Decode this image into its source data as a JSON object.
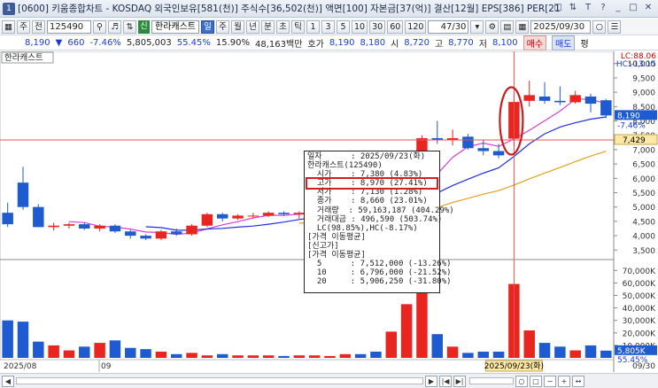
{
  "window": {
    "number": "1",
    "title": "[0600] 키움종합차트 - KOSDAQ 외국인보유[581(천)] 주식수[36,502(천)] 액면[100] 자본금[37(억)] 결산[12월] EPS[386] PER[21.18] 시가총액[2,9"
  },
  "toolbar": {
    "week_label": "주",
    "prev_label": "전",
    "code": "125490",
    "new_badge": "신",
    "stock_name": "한라캐스트",
    "periods": [
      "일",
      "주",
      "월",
      "년",
      "분",
      "초",
      "틱"
    ],
    "active_period": "일",
    "minute_options": [
      "1",
      "3",
      "5",
      "10",
      "30",
      "60",
      "120"
    ],
    "page": "47/30",
    "date": "2025/09/30"
  },
  "quote": {
    "price": "8,190",
    "change": "660",
    "change_pct": "-7.46%",
    "volume": "5,805,003",
    "volume_ratio": "55.45%",
    "turnover": "15.90%",
    "amount": "48,163백만",
    "bid_ask_label": "호가",
    "bid": "8,190",
    "ask": "8,180",
    "open_label": "시",
    "open": "8,720",
    "high_label": "고",
    "high": "8,770",
    "low_label": "저",
    "low": "8,100",
    "buy_label": "매수",
    "sell_label": "매도",
    "avg_label": "평"
  },
  "chart": {
    "name_tag": "한라캐스트",
    "lc_label": "LC:88.06",
    "hc_label": "HC:-13.15",
    "price_ticks": [
      "10,000",
      "9,500",
      "9,000",
      "8,500",
      "8,000",
      "7,500",
      "7,000",
      "6,500",
      "6,000",
      "5,500",
      "5,000",
      "4,500",
      "4,000",
      "3,500"
    ],
    "current_price": "8,190",
    "current_pct": "-7.46%",
    "crosshair_price": "7,429",
    "volume_ticks": [
      "70,000K",
      "60,000K",
      "50,000K",
      "40,000K",
      "30,000K",
      "20,000K",
      "10,000K"
    ],
    "volume_current": "5,805K",
    "volume_pct": "55.45%",
    "x_labels": [
      "2025/08",
      "09"
    ],
    "x_label_right": "09/30",
    "crosshair_date": "2025/09/23(화)",
    "colors": {
      "up": "#e8251f",
      "down": "#1e5bd0",
      "ma5": "#d63fd6",
      "ma10": "#1f2fe0",
      "ma20": "#e0a21e",
      "crosshair": "#e05656"
    }
  },
  "chart_data": {
    "type": "candlestick",
    "dates_visible": "2025/08 - 2025/09/30",
    "candles": [
      {
        "o": 4800,
        "h": 5150,
        "l": 4300,
        "c": 4400
      },
      {
        "o": 5850,
        "h": 6400,
        "l": 4900,
        "c": 5000
      },
      {
        "o": 5000,
        "h": 5100,
        "l": 4300,
        "c": 4300
      },
      {
        "o": 4300,
        "h": 4450,
        "l": 4180,
        "c": 4350
      },
      {
        "o": 4350,
        "h": 4450,
        "l": 4250,
        "c": 4400
      },
      {
        "o": 4400,
        "h": 4450,
        "l": 4200,
        "c": 4250
      },
      {
        "o": 4250,
        "h": 4400,
        "l": 4150,
        "c": 4350
      },
      {
        "o": 4350,
        "h": 4400,
        "l": 4100,
        "c": 4150
      },
      {
        "o": 4150,
        "h": 4200,
        "l": 3900,
        "c": 4000
      },
      {
        "o": 4000,
        "h": 4050,
        "l": 3850,
        "c": 3900
      },
      {
        "o": 3900,
        "h": 4200,
        "l": 3850,
        "c": 4150
      },
      {
        "o": 4150,
        "h": 4250,
        "l": 4000,
        "c": 4050
      },
      {
        "o": 4050,
        "h": 4400,
        "l": 4000,
        "c": 4350
      },
      {
        "o": 4350,
        "h": 4800,
        "l": 4300,
        "c": 4750
      },
      {
        "o": 4750,
        "h": 4800,
        "l": 4500,
        "c": 4600
      },
      {
        "o": 4600,
        "h": 4750,
        "l": 4550,
        "c": 4700
      },
      {
        "o": 4700,
        "h": 4800,
        "l": 4600,
        "c": 4700
      },
      {
        "o": 4700,
        "h": 4850,
        "l": 4650,
        "c": 4800
      },
      {
        "o": 4800,
        "h": 4850,
        "l": 4700,
        "c": 4750
      },
      {
        "o": 4750,
        "h": 4850,
        "l": 4600,
        "c": 4800
      },
      {
        "o": 4800,
        "h": 4900,
        "l": 4750,
        "c": 4850
      },
      {
        "o": 4850,
        "h": 4900,
        "l": 4800,
        "c": 4850
      },
      {
        "o": 4850,
        "h": 5000,
        "l": 4800,
        "c": 4950
      },
      {
        "o": 4950,
        "h": 5050,
        "l": 4650,
        "c": 4700
      },
      {
        "o": 4700,
        "h": 4900,
        "l": 4400,
        "c": 4500
      },
      {
        "o": 4500,
        "h": 5350,
        "l": 4400,
        "c": 5200
      },
      {
        "o": 5200,
        "h": 6500,
        "l": 5200,
        "c": 6300
      },
      {
        "o": 6300,
        "h": 7500,
        "l": 6200,
        "c": 7400
      },
      {
        "o": 7400,
        "h": 8000,
        "l": 7200,
        "c": 7350
      },
      {
        "o": 7350,
        "h": 7700,
        "l": 7150,
        "c": 7400
      },
      {
        "o": 7450,
        "h": 7550,
        "l": 7000,
        "c": 7050
      },
      {
        "o": 7050,
        "h": 7350,
        "l": 6800,
        "c": 6950
      },
      {
        "o": 6950,
        "h": 7200,
        "l": 6700,
        "c": 6800
      },
      {
        "o": 7380,
        "h": 8970,
        "l": 7130,
        "c": 8660
      },
      {
        "o": 8700,
        "h": 9400,
        "l": 8500,
        "c": 8900
      },
      {
        "o": 8850,
        "h": 9350,
        "l": 8600,
        "c": 8700
      },
      {
        "o": 8700,
        "h": 9200,
        "l": 8550,
        "c": 8650
      },
      {
        "o": 8650,
        "h": 9050,
        "l": 8600,
        "c": 8900
      },
      {
        "o": 8850,
        "h": 8950,
        "l": 8300,
        "c": 8600
      },
      {
        "o": 8720,
        "h": 8770,
        "l": 8100,
        "c": 8190
      }
    ],
    "volume_k": [
      30000,
      29000,
      13000,
      10000,
      6000,
      9000,
      12000,
      14000,
      8000,
      7000,
      5000,
      3000,
      4000,
      2000,
      3000,
      2000,
      2000,
      2000,
      1500,
      2000,
      2000,
      1500,
      3000,
      3000,
      5000,
      21000,
      43000,
      59000,
      19000,
      9000,
      4000,
      5000,
      5000,
      59163,
      22000,
      12000,
      9000,
      6000,
      10000,
      5805
    ],
    "price_range": [
      3200,
      10300
    ],
    "volume_range": [
      0,
      78000
    ],
    "moving_averages": [
      "5",
      "10",
      "20"
    ]
  },
  "tooltip": {
    "lines": [
      "일자      : 2025/09/23(화)",
      "한라캐스트(125490)",
      "  시가    : 7,380 (4.83%)",
      "  고가    : 8,970 (27.41%)",
      "  저가    : 7,130 (1.28%)",
      "  종가    : 8,660 (23.01%)",
      "  거래량  : 59,163,187 (404.29%)",
      "  거래대금 : 496,590 (503.74%)",
      "  LC(98.85%),HC(-8.17%)",
      "[가격 이동평균]",
      "[신고가]",
      "[가격 이동평균]",
      "  5      : 7,512,000 (-13.26%)",
      "  10     : 6,796,000 (-21.52%)",
      "  20     : 5,906,250 (-31.80%)"
    ],
    "highlight_index": 3
  }
}
